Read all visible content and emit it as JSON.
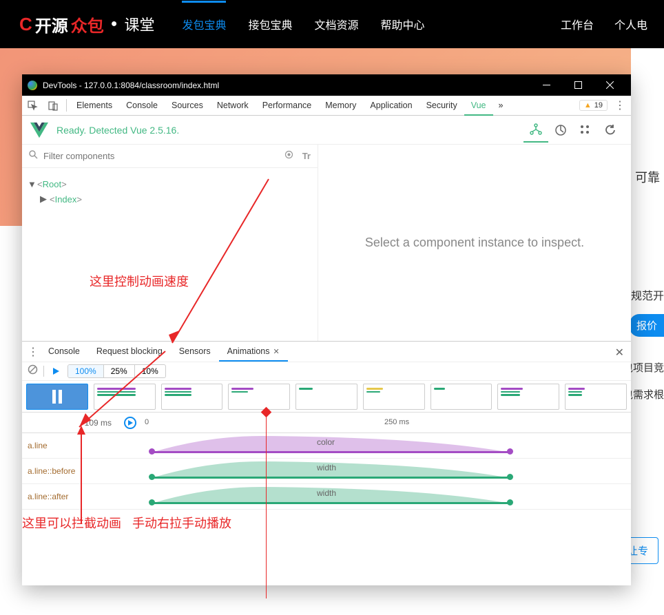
{
  "siteNav": {
    "logo_c": "C",
    "logo_t1": "开源",
    "logo_t2": "众包",
    "logo_dot": "●",
    "logo_sub": "课堂",
    "items": [
      "发包宝典",
      "接包宝典",
      "文档资源",
      "帮助中心"
    ],
    "right": [
      "工作台",
      "个人电"
    ]
  },
  "side": {
    "banner_txt": "可靠",
    "l1": "规范开",
    "pill": "报价",
    "l2": "包项目竞",
    "l3": "包需求根",
    "btn": "让专"
  },
  "devtools": {
    "title": "DevTools - 127.0.0.1:8084/classroom/index.html",
    "tabs": [
      "Elements",
      "Console",
      "Sources",
      "Network",
      "Performance",
      "Memory",
      "Application",
      "Security",
      "Vue"
    ],
    "warnCount": "19",
    "vue": {
      "status": "Ready. Detected Vue 2.5.16.",
      "filter_ph": "Filter components",
      "tree": {
        "root": "Root",
        "index": "Index"
      },
      "inspect_msg": "Select a component instance to inspect."
    },
    "drawer": {
      "tabs": [
        "Console",
        "Request blocking",
        "Sensors",
        "Animations"
      ],
      "speeds": [
        "100%",
        "25%",
        "10%"
      ],
      "tl_label": "109 ms",
      "ticks": {
        "t0": "0",
        "t250": "250 ms"
      },
      "rows": [
        {
          "label": "a.line",
          "prop": "color",
          "color": "#a44cc4"
        },
        {
          "label": "a.line::before",
          "prop": "width",
          "color": "#2aa876"
        },
        {
          "label": "a.line::after",
          "prop": "width",
          "color": "#2aa876"
        }
      ]
    }
  },
  "anno": {
    "speed": "这里控制动画速度",
    "intercept": "这里可以拦截动画",
    "drag": "手动右拉手动播放"
  }
}
